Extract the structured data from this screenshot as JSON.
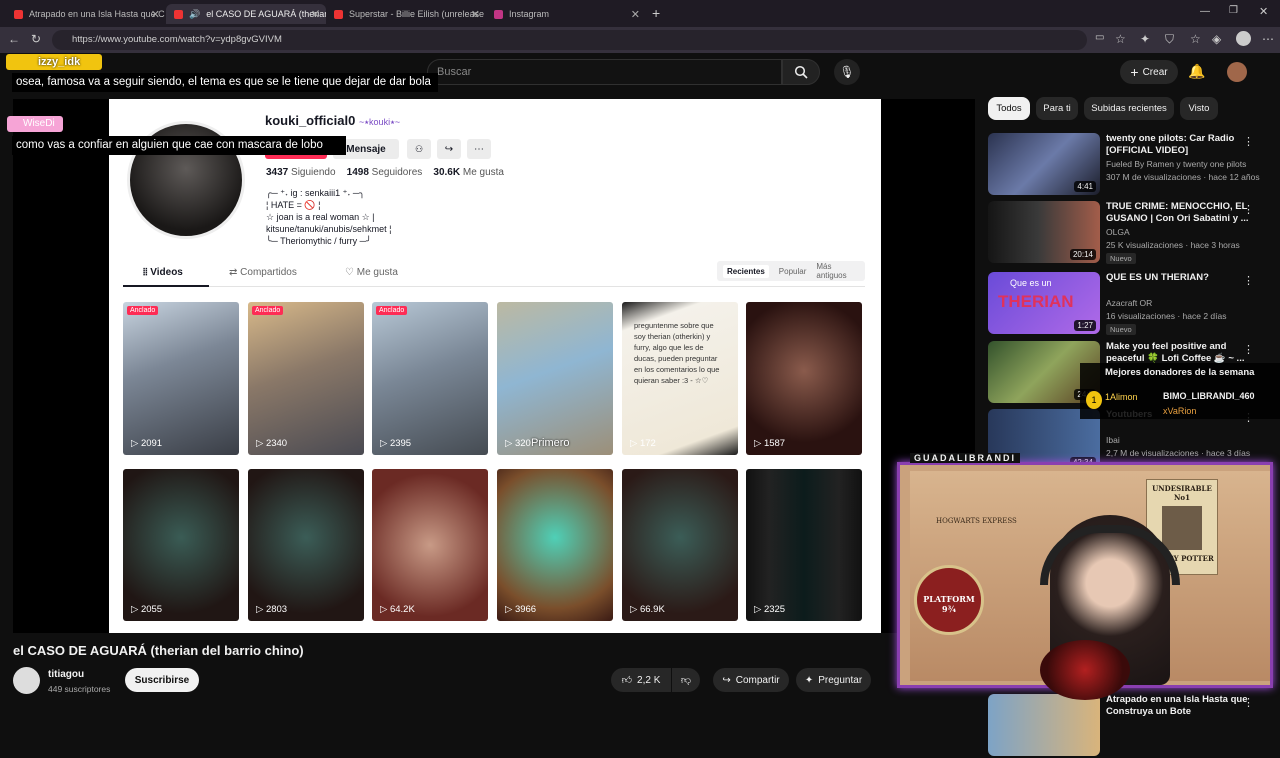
{
  "browser": {
    "tabs": [
      {
        "label": "Atrapado en una Isla Hasta que C",
        "fav": "#e33"
      },
      {
        "label": "el CASO DE AGUARÁ (therian",
        "fav": "#e33"
      },
      {
        "label": "Superstar - Billie Eilish (unrelease",
        "fav": "#e33"
      },
      {
        "label": "Instagram",
        "fav": "#c13584"
      }
    ],
    "url": "https://www.youtube.com/watch?v=ydp8gvGVIVM"
  },
  "youtube": {
    "search_placeholder": "Buscar",
    "create_label": "Crear",
    "chips": [
      "Todos",
      "Para ti",
      "Subidas recientes",
      "Visto"
    ],
    "video_title": "el CASO DE AGUARÁ (therian del barrio chino)",
    "channel": {
      "name": "titiagou",
      "subs": "449 suscriptores",
      "subscribe": "Suscribirse"
    },
    "actions": {
      "likes": "2,2 K",
      "share": "Compartir",
      "ask": "Preguntar"
    },
    "recommendations": [
      {
        "title": "twenty one pilots: Car Radio [OFFICIAL VIDEO]",
        "channel": "Fueled By Ramen y twenty one pilots",
        "meta": "307 M de visualizaciones · hace 12 años",
        "dur": "4:41",
        "badge": "",
        "bg": "linear-gradient(135deg,#2b3350,#6b7aa8 50%,#1b1d2a)"
      },
      {
        "title": "TRUE CRIME: MENOCCHIO, EL GUSANO | Con Ori Sabatini y ...",
        "channel": "OLGA",
        "meta": "25 K visualizaciones · hace 3 horas",
        "dur": "20:14",
        "badge": "Nuevo",
        "bg": "linear-gradient(90deg,#151515,#3a3a3a 45%,#a35d4a)"
      },
      {
        "title": "QUE ES UN THERIAN?",
        "channel": "Azacraft OR",
        "meta": "16 visualizaciones · hace 2 días",
        "dur": "1:27",
        "badge": "Nuevo",
        "bg": "linear-gradient(135deg,#6a4bd8,#b06ae8)"
      },
      {
        "title": "Make you feel positive and peaceful 🍀 Lofi Coffee ☕ ~ ...",
        "channel": "",
        "meta": "",
        "dur": "24:3",
        "badge": "",
        "bg": "linear-gradient(135deg,#33522c,#8fa45c 50%,#5a3f22)"
      },
      {
        "title": "Youtubers",
        "channel": "Ibai",
        "meta": "2,7 M de visualizaciones · hace 3 días",
        "dur": "42:34",
        "badge": "",
        "bg": "linear-gradient(90deg,#28385a,#4b6da0)"
      },
      {
        "title": "Atrapado en una Isla Hasta que Construya un Bote",
        "channel": "",
        "meta": "",
        "dur": "",
        "badge": "",
        "bg": "linear-gradient(90deg,#7da3c6,#d9b47b)"
      }
    ],
    "therian_thumb_text": {
      "line1": "Que es un",
      "line2": "THERIAN"
    }
  },
  "tiktok": {
    "username": "kouki_official0",
    "nick": "~⭑kouki⭑~",
    "message_btn": "Mensaje",
    "following": "3437",
    "following_label": "Siguiendo",
    "followers": "1498",
    "followers_label": "Seguidores",
    "likes": "30.6K",
    "likes_label": "Me gusta",
    "bio": [
      "╭─ ⁺˖ ig : senkaiii1 ⁺˖ ─╮",
      "¦ HATE = 🚫 ¦",
      "☆ joan is a real woman ☆ |",
      "kitsune/tanuki/anubis/sehkmet ¦",
      "╰─ Theriomythic / furry ─╯"
    ],
    "tabs": [
      "Videos",
      "Compartidos",
      "Me gusta"
    ],
    "sort": [
      "Recientes",
      "Popular",
      "Más antiguos"
    ],
    "pinned_label": "Anclado",
    "note_text": "preguntenme sobre que soy therian (otherkin) y furry, algo que les de ducas, pueden preguntar en los comentarios lo que quieran saber :3 - ☆♡",
    "overlay_word": "Primero",
    "videos": [
      {
        "count": "2091",
        "pinned": true,
        "bg": "linear-gradient(160deg,#c8d4e0,#7c8796 40%,#3a3e46)"
      },
      {
        "count": "2340",
        "pinned": true,
        "bg": "linear-gradient(160deg,#d8b98a,#8a7868 45%,#4a4a52)"
      },
      {
        "count": "2395",
        "pinned": true,
        "bg": "linear-gradient(160deg,#b8c8d6,#7a8796 45%,#454b52)"
      },
      {
        "count": "320",
        "pinned": false,
        "bg": "linear-gradient(160deg,#bcb9a2,#8fb6d2 45%,#9c8f78)"
      },
      {
        "count": "172",
        "pinned": false,
        "bg": "linear-gradient(160deg,#1a1a1a,#f4f1ea 15%,#efe8d8 85%,#1a1a1a)"
      },
      {
        "count": "1587",
        "pinned": false,
        "bg": "radial-gradient(circle at 50% 45%,#8a5b4c,#2a1210 70%)"
      },
      {
        "count": "2055",
        "pinned": false,
        "bg": "radial-gradient(circle at 50% 45%,#3a5c55,#201614 75%)"
      },
      {
        "count": "2803",
        "pinned": false,
        "bg": "radial-gradient(circle at 50% 45%,#3b5d57,#211614 75%)"
      },
      {
        "count": "64.2K",
        "pinned": false,
        "bg": "radial-gradient(circle at 50% 50%,#c89a86,#6b2a24 75%)"
      },
      {
        "count": "3966",
        "pinned": false,
        "bg": "radial-gradient(circle at 50% 45%,#4fd0b7,#7a4e2b 70%,#3a1a14)"
      },
      {
        "count": "66.9K",
        "pinned": false,
        "bg": "radial-gradient(circle at 50% 45%,#3b5d57,#2b1a17 75%)"
      },
      {
        "count": "2325",
        "pinned": false,
        "bg": "linear-gradient(90deg,#111,#222 20%,#0c1c1c 50%,#222 80%,#111)"
      }
    ]
  },
  "stream": {
    "chat": [
      {
        "user": "izzy_idk",
        "text": "osea, famosa va a seguir siendo, el tema es que se le tiene que dejar de dar bola"
      },
      {
        "user": "WiseDi",
        "text": "como vas a confiar en alguien que cae con mascara de lobo"
      }
    ],
    "donors_title": "Mejores donadores de la semana",
    "donors": [
      "1Alimon",
      "BIMO_LIBRANDI_460",
      "xVaRion"
    ],
    "cam_name": "GUADALIBRANDI",
    "poster_title": "UNDESIRABLE No1",
    "poster_name": "HARRY POTTER",
    "sign_title": "PLATFORM 9¾",
    "express_label": "HOGWARTS EXPRESS"
  }
}
